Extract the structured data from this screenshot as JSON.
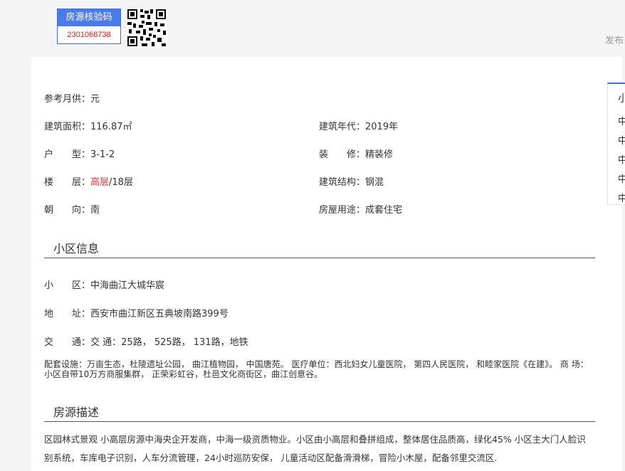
{
  "header": {
    "verify_title": "房源核验码",
    "verify_code": "2301068738",
    "publish_label": "发布"
  },
  "info": {
    "monthly_label": "参考月供：",
    "monthly_value": "元",
    "area_label": "建筑面积：",
    "area_value": "116.87㎡",
    "year_label": "建筑年代：",
    "year_value": "2019年",
    "layout_label": "户　　型：",
    "layout_value": "3-1-2",
    "decor_label": "装　　修：",
    "decor_value": "精装修",
    "floor_label": "楼　　层：",
    "floor_level": "高层",
    "floor_total": "/18层",
    "structure_label": "建筑结构：",
    "structure_value": "钢混",
    "orient_label": "朝　　向：",
    "orient_value": "南",
    "usage_label": "房屋用途：",
    "usage_value": "成套住宅"
  },
  "community": {
    "title": "小区信息",
    "name_label": "小　　区：",
    "name_value": "中海曲江大城华宸",
    "address_label": "地　　址：",
    "address_value": "西安市曲江新区五典坡南路399号",
    "traffic_label": "交　　通：",
    "traffic_value": "交 通：25路， 525路， 131路，地铁",
    "facilities_line1": "配套设施：万亩生态，杜陵遗址公园， 曲江植物园， 中国唐苑。 医疗单位：西北妇女儿童医院， 第四人民医院， 和睦家医院《在建》。 商 场：",
    "facilities_line2": "小区自带10万方商服集群， 正荣彩虹谷，杜邑文化商街区，曲江创意谷。"
  },
  "description": {
    "title": "房源描述",
    "line1": "区园林式景观 小高层房源中海央企开发商，中海一级资质物业。小区由小高层和叠拼组成，整体居住品质高，绿化45% 小区主大门人脸识",
    "line2": "别系统，车库电子识别，人车分流管理，24小时巡防安保， 儿童活动区配备滑滑梯，冒险小木屋，配备邻里交流区."
  },
  "side": {
    "title": "小",
    "items": [
      "中",
      "中",
      "中",
      "中",
      "中"
    ]
  },
  "colors": {
    "accent": "#4b7be8",
    "highlight": "#e03b3b",
    "code": "#e02020"
  }
}
